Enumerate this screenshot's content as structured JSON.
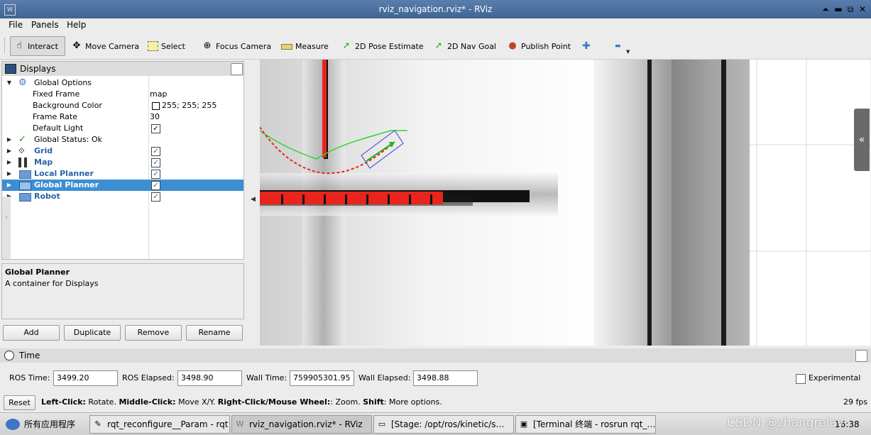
{
  "window": {
    "title": "rviz_navigation.rviz* - RViz",
    "logo_glyph": "W",
    "controls": [
      "⏶",
      "▬",
      "⧉",
      "✕"
    ]
  },
  "menu": [
    "File",
    "Panels",
    "Help"
  ],
  "toolbar": {
    "tools": [
      {
        "id": "interact",
        "label": "Interact",
        "icon": "hand-icon",
        "glyph": "☝",
        "active": true
      },
      {
        "id": "move-camera",
        "label": "Move Camera",
        "icon": "move-camera-icon",
        "glyph": "✥"
      },
      {
        "id": "select",
        "label": "Select",
        "icon": "select-box-icon",
        "glyph": "⬚"
      },
      {
        "id": "focus-camera",
        "label": "Focus Camera",
        "icon": "focus-camera-icon",
        "glyph": "⊕"
      },
      {
        "id": "measure",
        "label": "Measure",
        "icon": "ruler-icon",
        "glyph": "▭"
      },
      {
        "id": "pose-estimate",
        "label": "2D Pose Estimate",
        "icon": "green-arrow-icon",
        "glyph": "➚"
      },
      {
        "id": "nav-goal",
        "label": "2D Nav Goal",
        "icon": "green-arrow-icon",
        "glyph": "➚"
      },
      {
        "id": "publish-point",
        "label": "Publish Point",
        "icon": "map-pin-icon",
        "glyph": "●"
      }
    ],
    "add_glyph": "✚",
    "remove_glyph": "▬"
  },
  "displays": {
    "title": "Displays",
    "global_options": {
      "label": "Global Options",
      "fixed_frame_label": "Fixed Frame",
      "fixed_frame_value": "map",
      "background_color_label": "Background Color",
      "background_color_value": "255; 255; 255",
      "frame_rate_label": "Frame Rate",
      "frame_rate_value": "30",
      "default_light_label": "Default Light",
      "check": "✓"
    },
    "global_status": "Global Status: Ok",
    "items": [
      {
        "label": "Grid",
        "icon": "grid-icon"
      },
      {
        "label": "Map",
        "icon": "map-icon"
      },
      {
        "label": "Local Planner",
        "icon": "folder-icon"
      },
      {
        "label": "Global Planner",
        "icon": "folder-icon",
        "selected": true
      },
      {
        "label": "Robot",
        "icon": "folder-icon"
      }
    ],
    "check": "✓"
  },
  "description": {
    "title": "Global Planner",
    "text": "A container for Displays"
  },
  "buttons": {
    "add": "Add",
    "duplicate": "Duplicate",
    "remove": "Remove",
    "rename": "Rename"
  },
  "time": {
    "title": "Time",
    "ros_time_label": "ROS Time:",
    "ros_time_value": "3499.20",
    "ros_elapsed_label": "ROS Elapsed:",
    "ros_elapsed_value": "3498.90",
    "wall_time_label": "Wall Time:",
    "wall_time_value": "759905301.95",
    "wall_elapsed_label": "Wall Elapsed:",
    "wall_elapsed_value": "3498.88",
    "experimental_label": "Experimental"
  },
  "status": {
    "reset": "Reset",
    "left_click": "Left-Click:",
    "left_click_action": " Rotate. ",
    "middle_click": "Middle-Click:",
    "middle_click_action": " Move X/Y. ",
    "right_click": "Right-Click/Mouse Wheel:",
    "right_click_action": ": Zoom. ",
    "shift": "Shift",
    "shift_action": ": More options.",
    "fps": "29 fps"
  },
  "taskbar": {
    "apps_label": "所有应用程序",
    "tasks": [
      {
        "label": "rqt_reconfigure__Param - rqt",
        "icon": "notepad-icon",
        "glyph": "✎"
      },
      {
        "label": "rviz_navigation.rviz* - RViz",
        "icon": "rviz-icon",
        "glyph": "W",
        "active": true
      },
      {
        "label": "[Stage: /opt/ros/kinetic/s…",
        "icon": "window-icon",
        "glyph": "▭"
      },
      {
        "label": "[Terminal 终端 - rosrun rqt_…",
        "icon": "terminal-icon",
        "glyph": "▣"
      }
    ],
    "clock": "16:38",
    "watermark": "CSDN @zhangrelay"
  },
  "colors": {
    "title_bar": "#4a70a0",
    "selection": "#3d8ed2",
    "obstacle": "#e8241b",
    "global_path": "#e8241b",
    "local_path": "#2fd42f",
    "robot_footprint": "#3b3bd8"
  }
}
